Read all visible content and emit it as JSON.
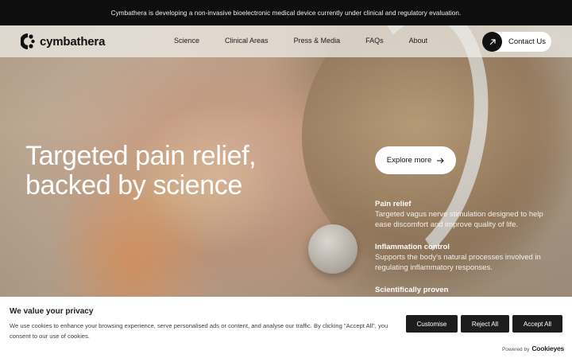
{
  "announcement": "Cymbathera is developing a non-invasive bioelectronic medical device currently under clinical and regulatory evaluation.",
  "nav": {
    "brand": "cymbathera",
    "links": [
      "Science",
      "Clinical Areas",
      "Press & Media",
      "FAQs",
      "About"
    ],
    "contact_label": "Contact Us",
    "contact_icon": "arrow-up-right-icon"
  },
  "hero": {
    "headline": "Targeted pain relief, backed by science",
    "cta_label": "Explore more",
    "cta_icon": "arrow-right-icon",
    "features": [
      {
        "title": "Pain relief",
        "desc": "Targeted vagus nerve stimulation designed to help ease discomfort and improve quality of life."
      },
      {
        "title": "Inflammation control",
        "desc": "Supports the body's natural processes involved in regulating inflammatory responses."
      },
      {
        "title": "Scientifically proven",
        "desc": ""
      }
    ]
  },
  "cookie": {
    "title": "We value your privacy",
    "text": "We use cookies to enhance your browsing experience, serve personalised ads or content, and analyse our traffic. By clicking \"Accept All\", you consent to our use of cookies.",
    "customise": "Customise",
    "reject": "Reject All",
    "accept": "Accept All",
    "powered_by": "Powered by",
    "powered_brand": "Cookieyes"
  },
  "colors": {
    "announce_bg": "#0e0e0e",
    "button_dark": "#1d1d1d",
    "text_light": "#ffffff"
  }
}
